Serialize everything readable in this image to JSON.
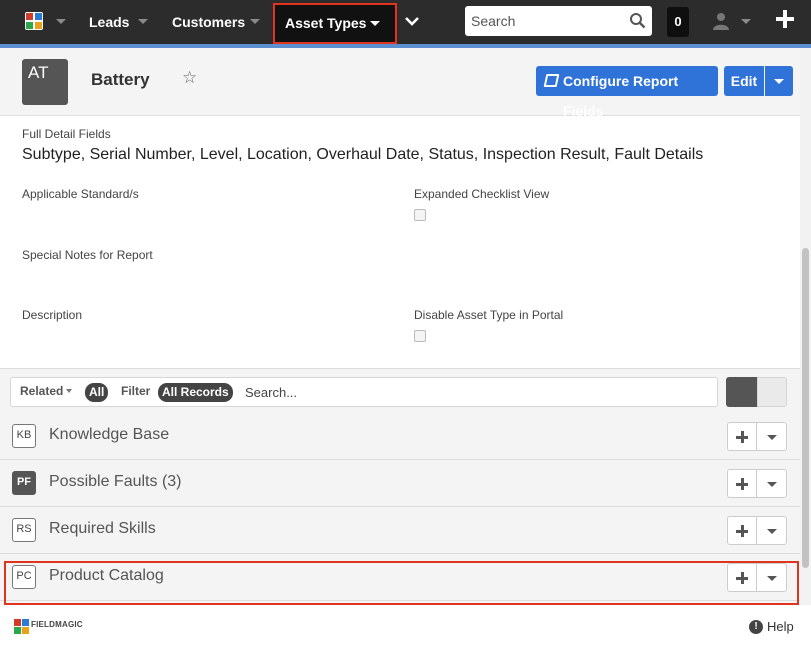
{
  "nav": {
    "items": [
      "Leads",
      "Customers"
    ],
    "active": "Asset Types",
    "search_placeholder": "Search",
    "notification_count": "0",
    "colors": {
      "bar": "#2c2c2c",
      "accent": "#5b8fd0",
      "highlight": "#e0341f"
    }
  },
  "record": {
    "avatar_text": "AT",
    "title": "Battery",
    "configure_label": "Configure Report Fields",
    "edit_label": "Edit",
    "button_color": "#2f73d8"
  },
  "details": {
    "full_detail_label": "Full Detail Fields",
    "full_detail_value": "Subtype, Serial Number, Level, Location, Overhaul Date, Status, Inspection Result, Fault Details",
    "applicable_label": "Applicable Standard/s",
    "expanded_label": "Expanded Checklist View",
    "special_label": "Special Notes for Report",
    "description_label": "Description",
    "disable_label": "Disable Asset Type in Portal"
  },
  "related": {
    "related_label": "Related",
    "all_label": "All",
    "filter_label": "Filter",
    "all_records_label": "All Records",
    "search_placeholder": "Search...",
    "lists": [
      {
        "icon": "KB",
        "label": "Knowledge Base"
      },
      {
        "icon": "PF",
        "label": "Possible Faults (3)"
      },
      {
        "icon": "RS",
        "label": "Required Skills"
      },
      {
        "icon": "PC",
        "label": "Product Catalog"
      }
    ]
  },
  "footer": {
    "brand": "FIELDMAGIC",
    "help_label": "Help"
  }
}
